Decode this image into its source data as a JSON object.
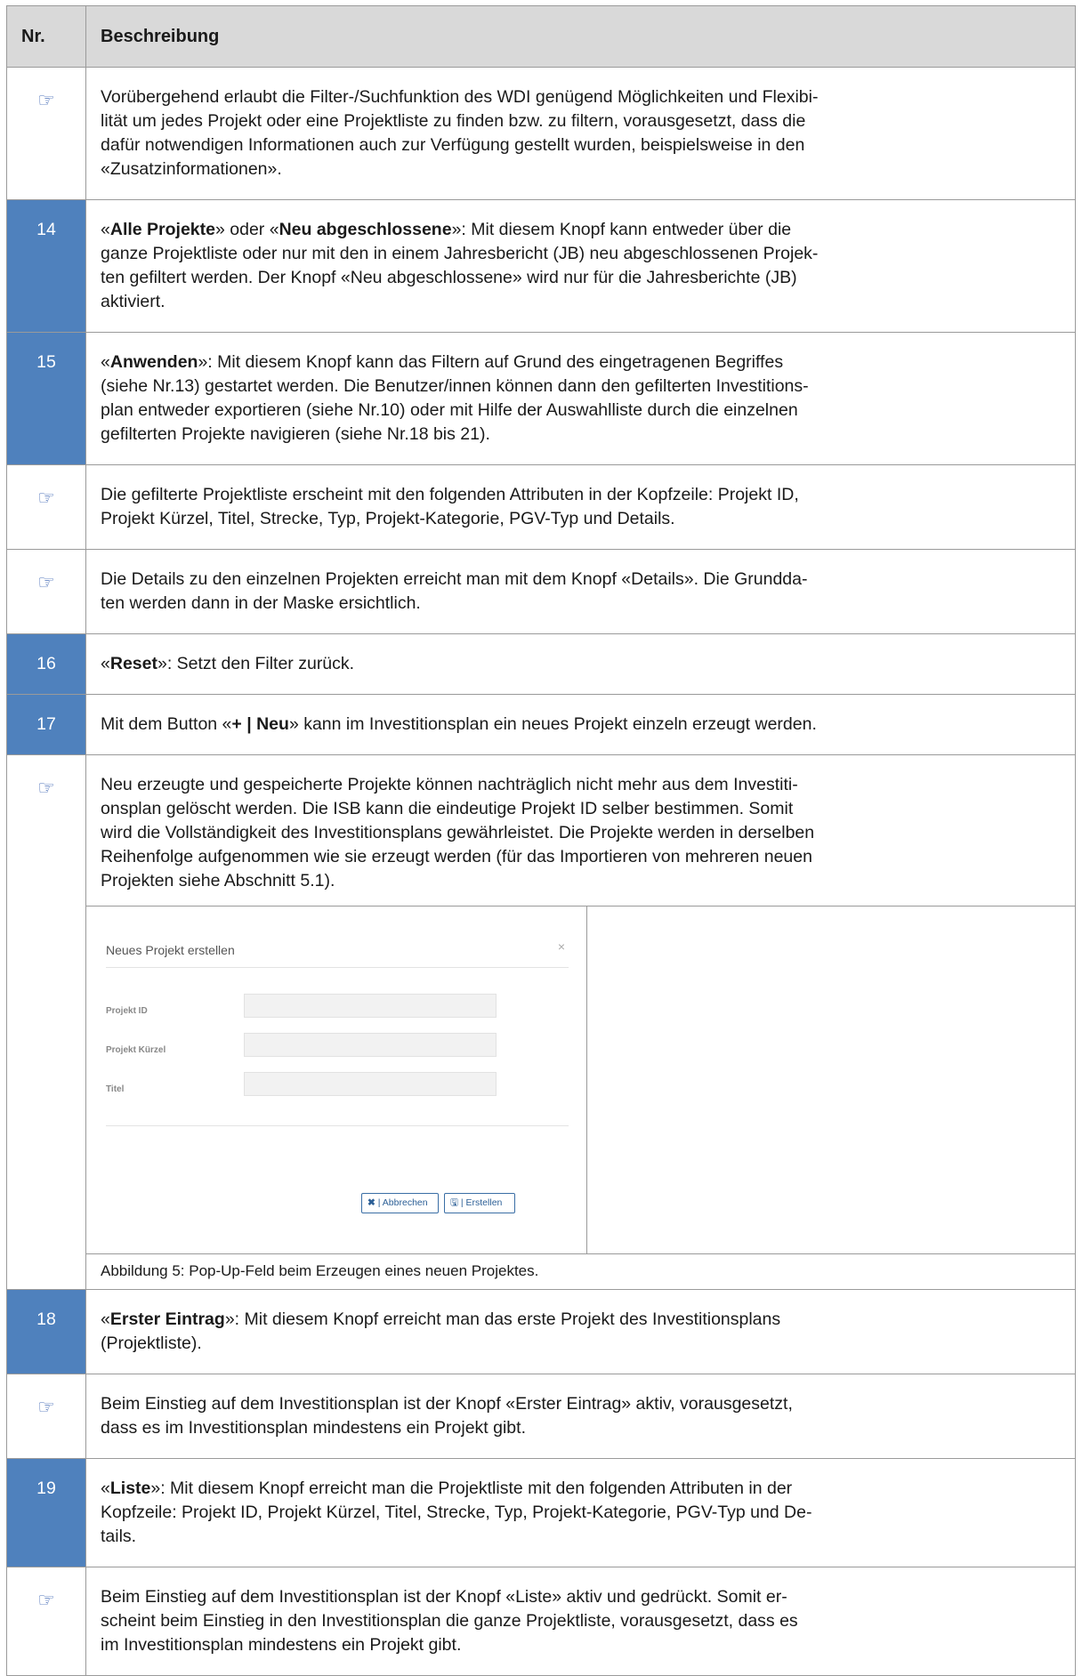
{
  "header": {
    "nr": "Nr.",
    "desc": "Beschreibung"
  },
  "rows": [
    {
      "nr": "",
      "html": "Vorübergehend erlaubt die Filter-/Suchfunktion des WDI genügend Möglichkeiten und Flexibi-<br>lität um jedes Projekt oder eine Projektliste zu finden bzw. zu filtern, vorausgesetzt, dass die<br>dafür notwendigen Informationen auch zur Verfügung gestellt wurden, beispielsweise in den<br>«Zusatzinformationen»."
    },
    {
      "nr": "14",
      "html": "«<b>Alle Projekte</b>» oder «<b>Neu abgeschlossene</b>»: Mit diesem Knopf kann entweder über die<br>ganze Projektliste oder nur mit den in einem Jahresbericht (JB) neu abgeschlossenen Projek-<br>ten gefiltert werden. Der Knopf «Neu abgeschlossene» wird nur für die Jahresberichte (JB)<br>aktiviert."
    },
    {
      "nr": "15",
      "html": "«<b>Anwenden</b>»: Mit diesem Knopf kann das Filtern auf Grund des eingetragenen Begriffes<br>(siehe Nr.13) gestartet werden. Die Benutzer/innen können dann den gefilterten Investitions-<br>plan entweder exportieren (siehe Nr.10) oder mit Hilfe der Auswahlliste durch die einzelnen<br>gefilterten Projekte navigieren (siehe Nr.18 bis 21)."
    },
    {
      "nr": "",
      "html": "Die gefilterte Projektliste erscheint mit den folgenden Attributen in der Kopfzeile: Projekt ID,<br>Projekt Kürzel, Titel, Strecke, Typ, Projekt-Kategorie, PGV-Typ und Details."
    },
    {
      "nr": "",
      "html": "Die Details zu den einzelnen Projekten erreicht man mit dem Knopf «Details». Die Grundda-<br>ten werden dann in der Maske ersichtlich."
    },
    {
      "nr": "16",
      "html": "«<b>Reset</b>»: Setzt den Filter zurück."
    },
    {
      "nr": "17",
      "html": "Mit dem Button «<b>+ | Neu</b>» kann im Investitionsplan ein neues Projekt einzeln erzeugt werden."
    },
    {
      "nr": "",
      "html": "Neu erzeugte und gespeicherte Projekte können nachträglich nicht mehr aus dem Investiti-<br>onsplan gelöscht werden. Die ISB kann die eindeutige Projekt ID selber bestimmen. Somit<br>wird die Vollständigkeit des Investitionsplans gewährleistet. Die Projekte werden in derselben<br>Reihenfolge aufgenommen wie sie erzeugt werden (für das Importieren von mehreren neuen<br>Projekten siehe Abschnitt 5.1).",
      "figure": true
    },
    {
      "nr": "18",
      "html": "«<b>Erster Eintrag</b>»: Mit diesem Knopf erreicht man das erste Projekt des Investitionsplans<br>(Projektliste)."
    },
    {
      "nr": "",
      "html": "Beim Einstieg auf dem Investitionsplan ist der Knopf «Erster Eintrag» aktiv, vorausgesetzt,<br>dass es im Investitionsplan mindestens ein Projekt gibt."
    },
    {
      "nr": "19",
      "html": "«<b>Liste</b>»: Mit diesem Knopf erreicht man die Projektliste mit den folgenden Attributen in der<br>Kopfzeile: Projekt ID, Projekt Kürzel, Titel, Strecke, Typ, Projekt-Kategorie, PGV-Typ und De-<br>tails."
    },
    {
      "nr": "",
      "html": "Beim Einstieg auf dem Investitionsplan ist der Knopf «Liste» aktiv und gedrückt. Somit er-<br>scheint beim Einstieg in den Investitionsplan die ganze Projektliste, vorausgesetzt, dass es<br>im Investitionsplan mindestens ein Projekt gibt."
    }
  ],
  "hand_icon": "pointing-hand-icon",
  "figure": {
    "modal_title": "Neues Projekt erstellen",
    "close": "×",
    "labels": [
      "Projekt ID",
      "Projekt Kürzel",
      "Titel"
    ],
    "btn_cancel_icon": "✖",
    "btn_cancel": "| Abbrechen",
    "btn_create_icon": "🖫",
    "btn_create": "| Erstellen",
    "caption": "Abbildung 5: Pop-Up-Feld beim Erzeugen eines neuen Projektes."
  },
  "colors": {
    "number_cell": "#4f81bd",
    "header": "#d9d9d9"
  }
}
